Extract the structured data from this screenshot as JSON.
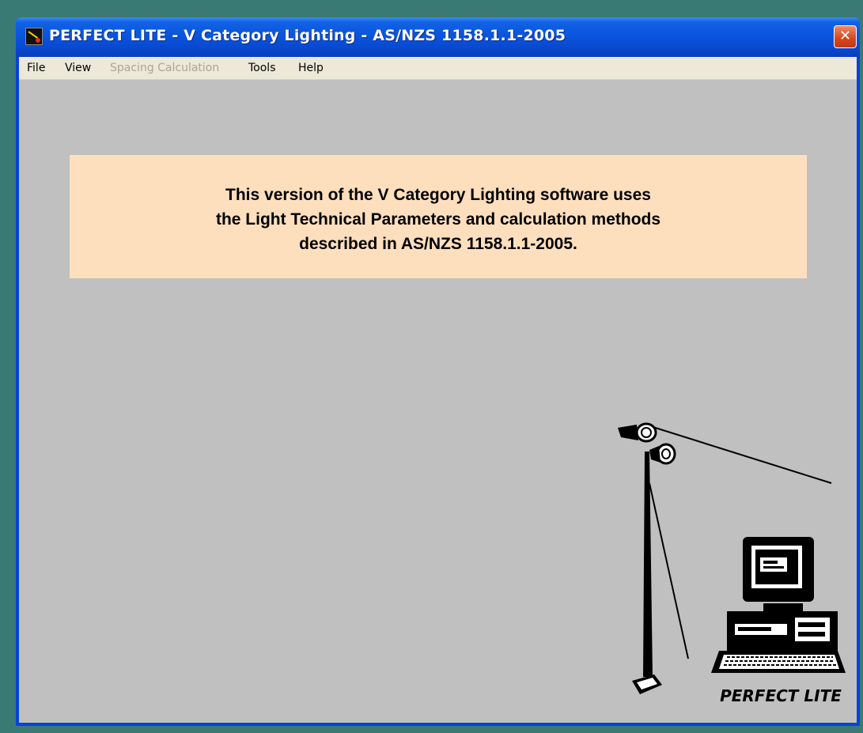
{
  "window": {
    "title": "PERFECT LITE - V Category Lighting - AS/NZS 1158.1.1-2005",
    "close_label": "✕"
  },
  "menu": {
    "items": [
      {
        "label": "File",
        "enabled": true
      },
      {
        "label": "View",
        "enabled": true
      },
      {
        "label": "Spacing Calculation",
        "enabled": false
      },
      {
        "label": "Tools",
        "enabled": true
      },
      {
        "label": "Help",
        "enabled": true
      }
    ]
  },
  "notice": {
    "lines": [
      "This version of the V Category Lighting software uses",
      "the Light Technical Parameters and calculation methods",
      "described in AS/NZS 1158.1.1-2005."
    ]
  },
  "logo": {
    "text": "PERFECT LITE"
  },
  "colors": {
    "desktop": "#3a7a74",
    "titlebar": "#0a55dc",
    "client_bg": "#c0c0c0",
    "notice_bg": "#fedfbd",
    "close_button": "#d8441c"
  }
}
